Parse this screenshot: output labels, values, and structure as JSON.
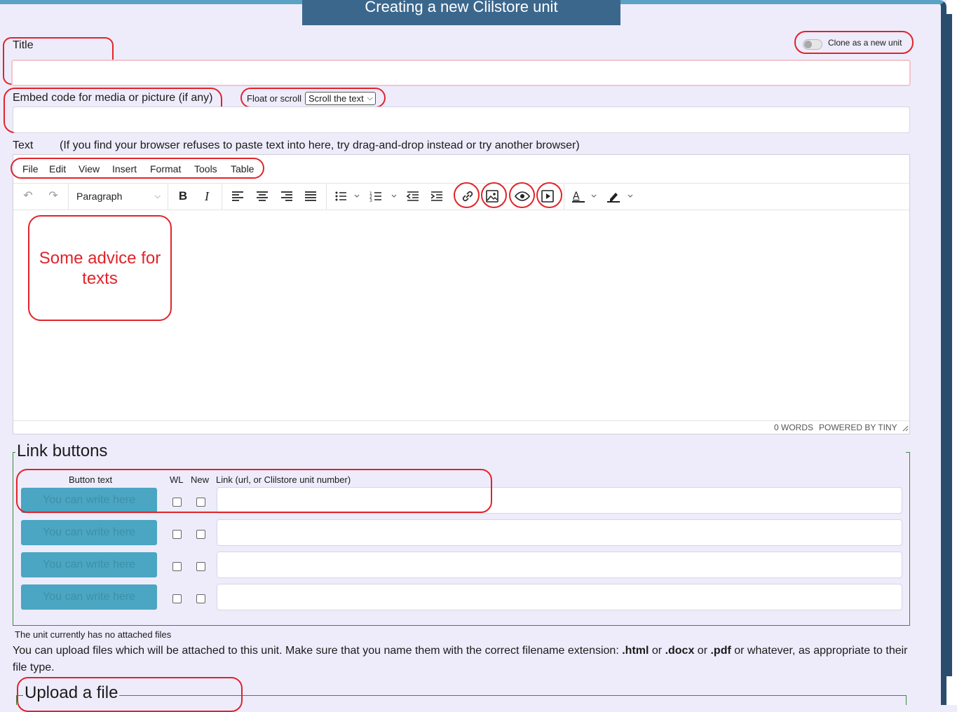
{
  "header": {
    "title": "Creating a new Clilstore unit"
  },
  "form": {
    "title_label": "Title",
    "clone_label": "Clone as a new unit",
    "embed_label": "Embed code for media or picture (if any)",
    "float_label": "Float or scroll",
    "float_select_value": "Scroll the text",
    "text_label": "Text",
    "text_hint": "(If you find your browser refuses to paste text into here, try drag-and-drop instead or try another browser)"
  },
  "editor": {
    "menu": [
      "File",
      "Edit",
      "View",
      "Insert",
      "Format",
      "Tools",
      "Table"
    ],
    "block_format": "Paragraph",
    "status_words": "0 WORDS",
    "status_powered": "POWERED BY TINY",
    "icons": [
      "undo-icon",
      "redo-icon",
      "bold-icon",
      "italic-icon",
      "align-left-icon",
      "align-center-icon",
      "align-right-icon",
      "justify-icon",
      "bullet-list-icon",
      "numbered-list-icon",
      "outdent-icon",
      "indent-icon",
      "link-icon",
      "image-icon",
      "preview-icon",
      "media-icon",
      "text-color-icon",
      "highlight-icon"
    ]
  },
  "annotation": {
    "advice": "Some advice for texts"
  },
  "link_buttons": {
    "legend": "Link buttons",
    "col_button_text": "Button text",
    "col_wl": "WL",
    "col_new": "New",
    "col_link": "Link (url, or Clilstore unit number)",
    "rows": [
      {
        "placeholder": "You can write here"
      },
      {
        "placeholder": "You can write here"
      },
      {
        "placeholder": "You can write here"
      },
      {
        "placeholder": "You can write here"
      }
    ]
  },
  "files": {
    "no_files": "The unit currently has no attached files",
    "info_part1": "You can upload files which will be attached to this unit. Make sure that you name them with the correct filename extension: ",
    "ext_html": ".html",
    "or1": " or ",
    "ext_docx": ".docx",
    "or2": " or ",
    "ext_pdf": ".pdf",
    "info_part2": " or whatever, as appropriate to their file type.",
    "upload_legend": "Upload a file"
  },
  "colors": {
    "accent_red": "#e0242a",
    "banner": "#3c678d",
    "button_teal": "#4aa6c2",
    "background": "#eeecfb"
  }
}
